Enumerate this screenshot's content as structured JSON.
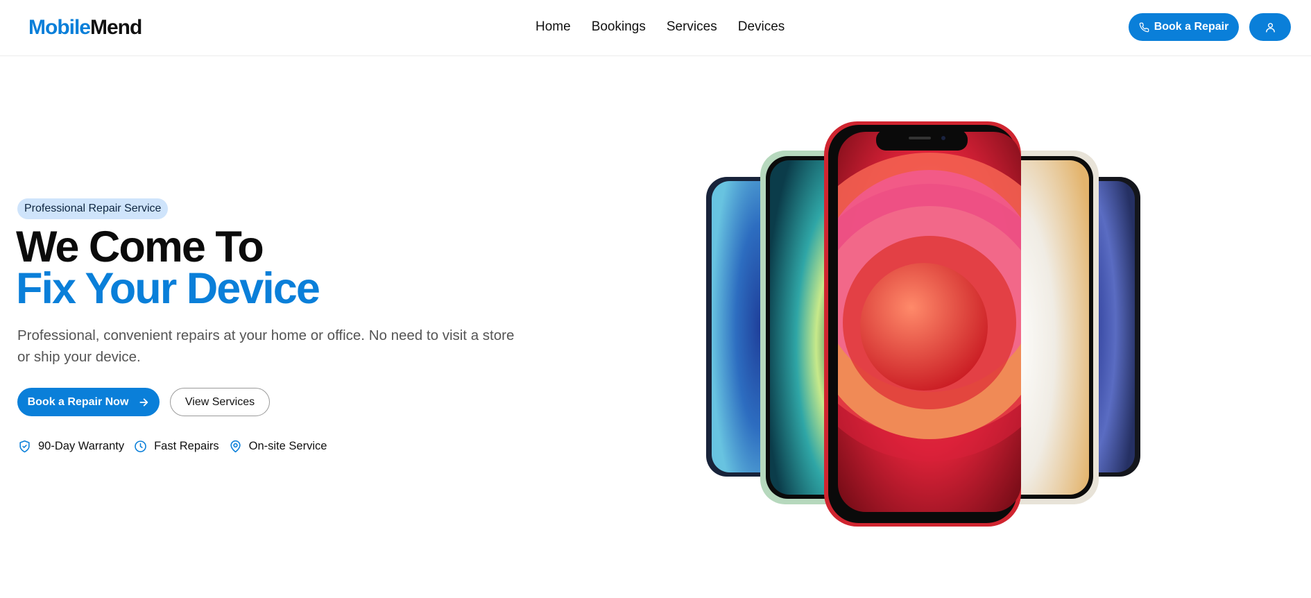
{
  "brand": {
    "part1": "Mobile",
    "part2": "Mend",
    "accent_color": "#0a7fd9"
  },
  "nav": {
    "items": [
      "Home",
      "Bookings",
      "Services",
      "Devices"
    ]
  },
  "header": {
    "book_button": "Book a Repair",
    "book_icon": "phone-icon",
    "user_icon": "user-icon"
  },
  "hero": {
    "badge": "Professional Repair Service",
    "title_line1": "We Come To",
    "title_line2": "Fix Your Device",
    "description": "Professional, convenient repairs at your home or office. No need to visit a store or ship your device.",
    "primary_button": "Book a Repair Now",
    "primary_icon": "arrow-right-icon",
    "secondary_button": "View Services",
    "features": [
      {
        "icon": "shield-check-icon",
        "label": "90-Day Warranty"
      },
      {
        "icon": "clock-icon",
        "label": "Fast Repairs"
      },
      {
        "icon": "map-pin-icon",
        "label": "On-site Service"
      }
    ]
  }
}
